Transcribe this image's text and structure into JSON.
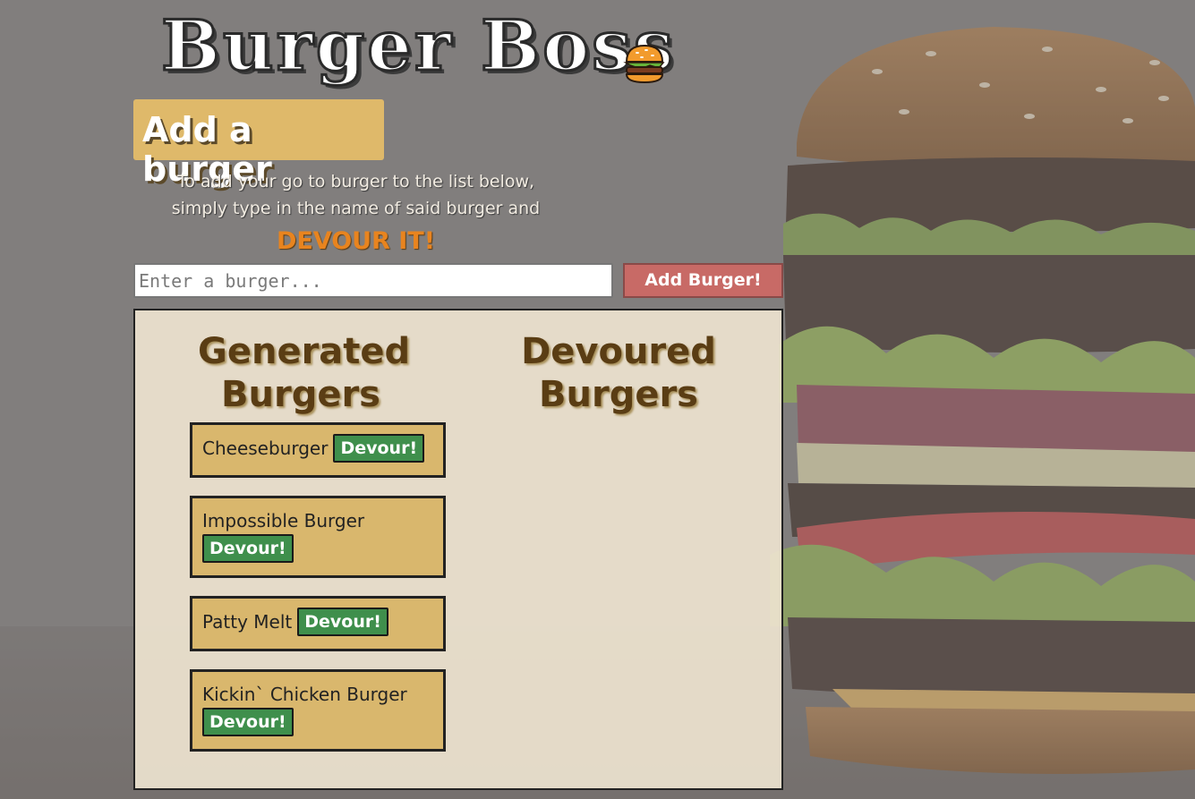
{
  "header": {
    "title": "Burger Boss",
    "title_icon": "burger-emoji-icon"
  },
  "add_section": {
    "banner_label": "Add a burger",
    "instructions": "To add your go to burger to the list below, simply type in the name of said burger and",
    "call_to_action": "DEVOUR IT!",
    "input_value": "",
    "input_placeholder": "Enter a burger...",
    "add_button_label": "Add Burger!"
  },
  "columns": {
    "generated_heading": "Generated Burgers",
    "devoured_heading": "Devoured Burgers"
  },
  "generated_burgers": [
    {
      "name": "Cheeseburger",
      "button": "Devour!"
    },
    {
      "name": "Impossible Burger",
      "button": "Devour!"
    },
    {
      "name": "Patty Melt",
      "button": "Devour!"
    },
    {
      "name": "Kickin` Chicken Burger",
      "button": "Devour!"
    }
  ],
  "devoured_burgers": [],
  "colors": {
    "page_background": "#7d7a79",
    "banner": "#dfb96a",
    "accent_orange": "#e8841f",
    "add_button": "#c86a66",
    "card": "#d9b76d",
    "devour_button": "#3f8f4c",
    "heading_brown": "#5a3d14"
  }
}
